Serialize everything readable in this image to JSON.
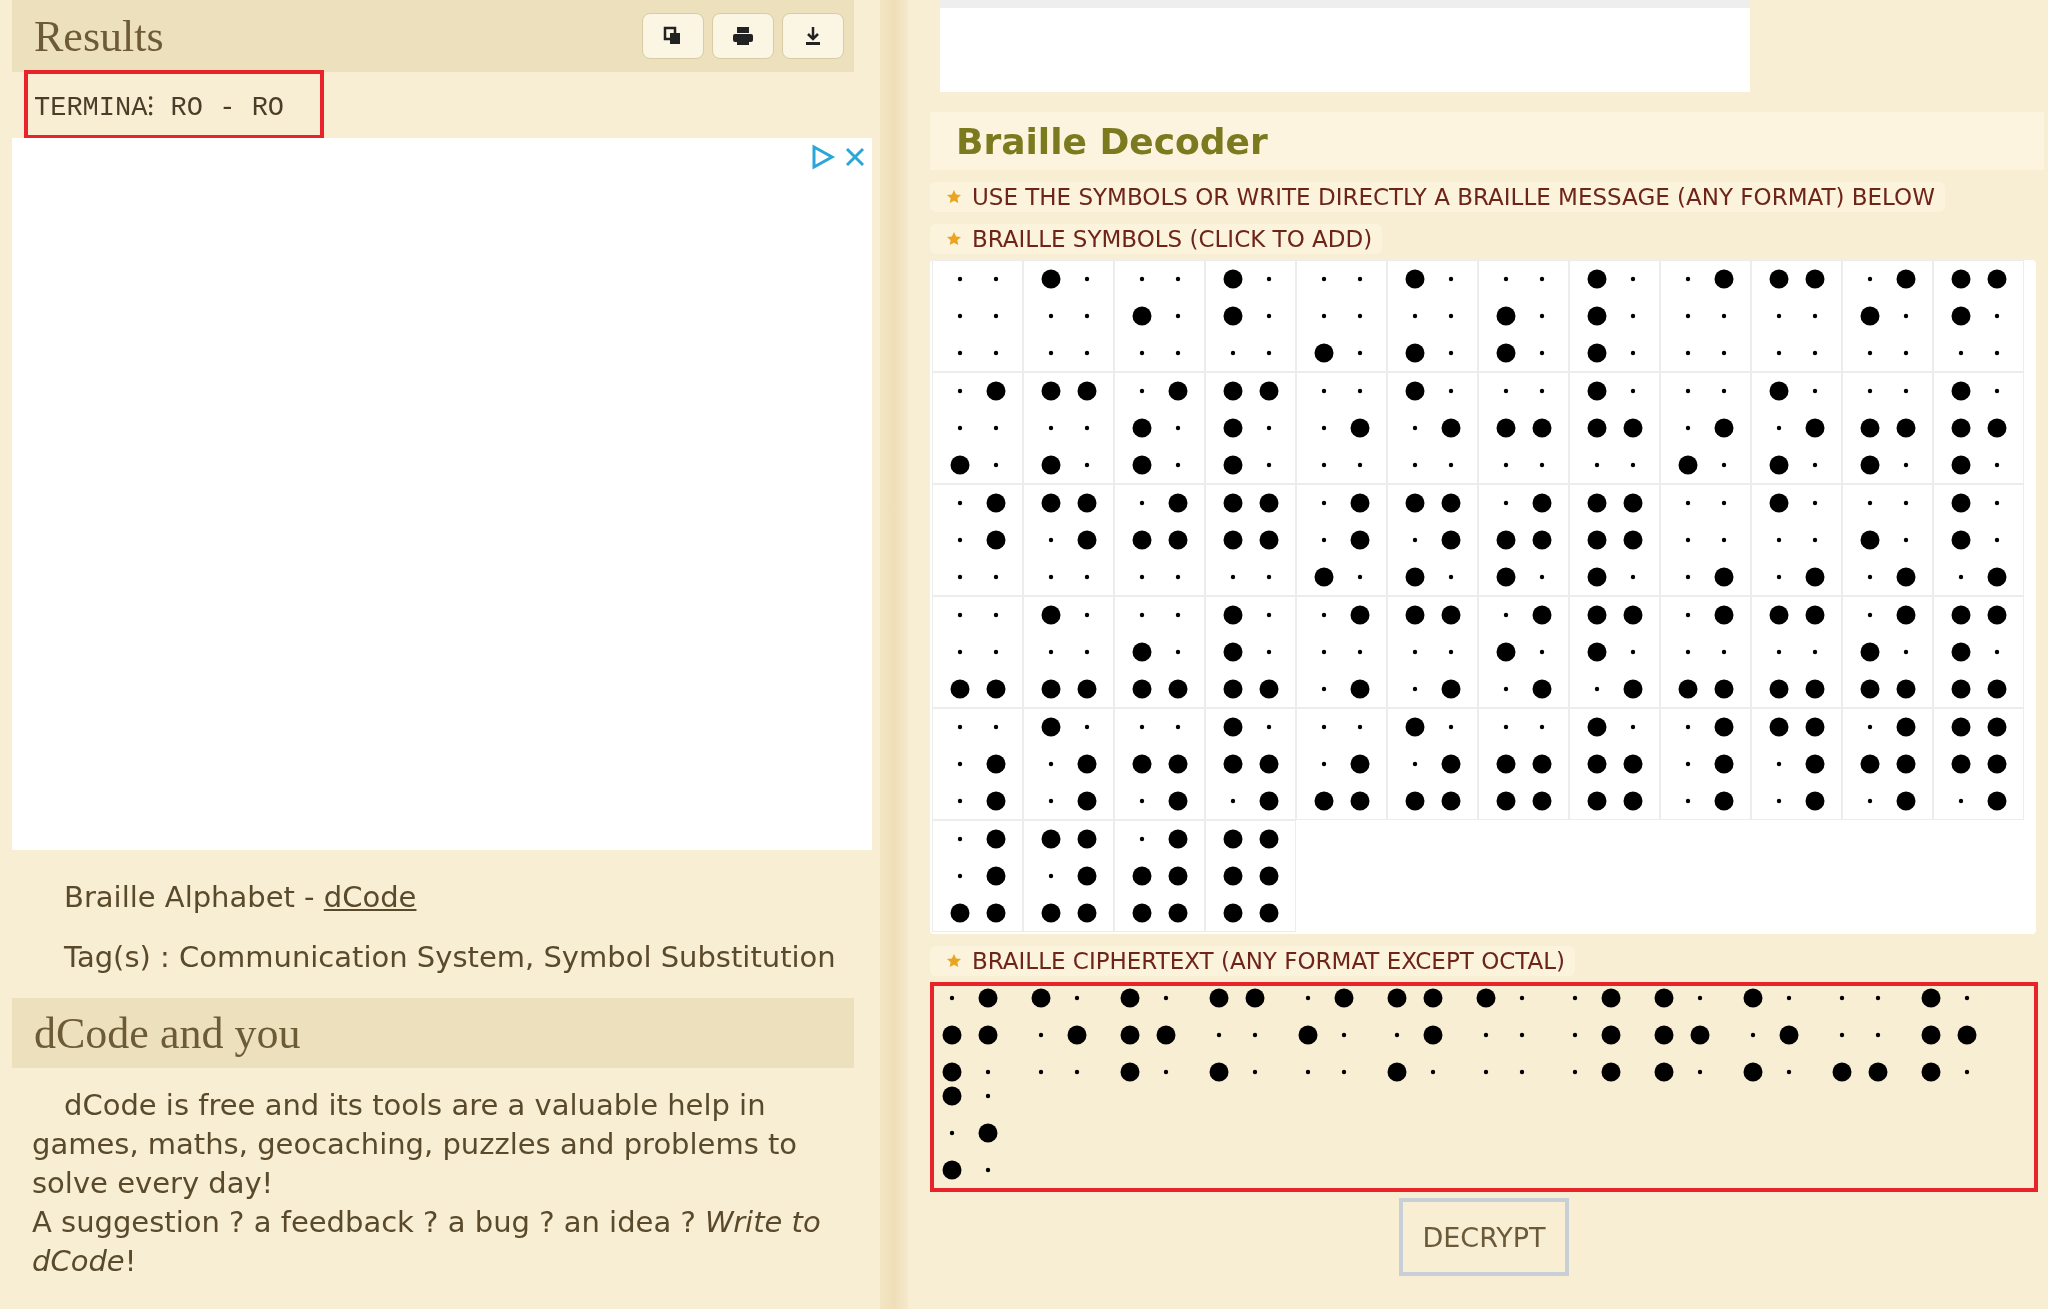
{
  "results": {
    "title": "Results",
    "buttons": [
      {
        "kind": "copy"
      },
      {
        "kind": "print"
      },
      {
        "kind": "download"
      }
    ],
    "output": "TERMINA⁝ RO - RO"
  },
  "page_info": {
    "title_prefix": "Braille Alphabet - ",
    "title_link": "dCode",
    "tags": "Tag(s) : Communication System, Symbol Substitution"
  },
  "about": {
    "title": "dCode and you",
    "text": "dCode is free and its tools are a valuable help in games, maths, geocaching, puzzles and problems to solve every day!",
    "suggestion": "A suggestion ? a feedback ? a bug ? an idea ? *Write to dCode*!"
  },
  "decoder": {
    "title": "Braille Decoder",
    "instruction": "USE THE SYMBOLS OR WRITE DIRECTLY A BRAILLE MESSAGE (ANY FORMAT) BELOW",
    "symbols_label": "BRAILLE SYMBOLS (CLICK TO ADD)",
    "symbols": [
      {
        "dots": [
          false,
          false,
          false,
          false,
          false,
          false
        ]
      },
      {
        "dots": [
          true,
          false,
          false,
          false,
          false,
          false
        ]
      },
      {
        "dots": [
          false,
          true,
          false,
          false,
          false,
          false
        ]
      },
      {
        "dots": [
          true,
          true,
          false,
          false,
          false,
          false
        ]
      },
      {
        "dots": [
          false,
          false,
          true,
          false,
          false,
          false
        ]
      },
      {
        "dots": [
          true,
          false,
          true,
          false,
          false,
          false
        ]
      },
      {
        "dots": [
          false,
          true,
          true,
          false,
          false,
          false
        ]
      },
      {
        "dots": [
          true,
          true,
          true,
          false,
          false,
          false
        ]
      },
      {
        "dots": [
          false,
          false,
          false,
          true,
          false,
          false
        ]
      },
      {
        "dots": [
          true,
          false,
          false,
          true,
          false,
          false
        ]
      },
      {
        "dots": [
          false,
          true,
          false,
          true,
          false,
          false
        ]
      },
      {
        "dots": [
          true,
          true,
          false,
          true,
          false,
          false
        ]
      },
      {
        "dots": [
          false,
          false,
          true,
          true,
          false,
          false
        ]
      },
      {
        "dots": [
          true,
          false,
          true,
          true,
          false,
          false
        ]
      },
      {
        "dots": [
          false,
          true,
          true,
          true,
          false,
          false
        ]
      },
      {
        "dots": [
          true,
          true,
          true,
          true,
          false,
          false
        ]
      },
      {
        "dots": [
          false,
          false,
          false,
          false,
          true,
          false
        ]
      },
      {
        "dots": [
          true,
          false,
          false,
          false,
          true,
          false
        ]
      },
      {
        "dots": [
          false,
          true,
          false,
          false,
          true,
          false
        ]
      },
      {
        "dots": [
          true,
          true,
          false,
          false,
          true,
          false
        ]
      },
      {
        "dots": [
          false,
          false,
          true,
          false,
          true,
          false
        ]
      },
      {
        "dots": [
          true,
          false,
          true,
          false,
          true,
          false
        ]
      },
      {
        "dots": [
          false,
          true,
          true,
          false,
          true,
          false
        ]
      },
      {
        "dots": [
          true,
          true,
          true,
          false,
          true,
          false
        ]
      },
      {
        "dots": [
          false,
          false,
          false,
          true,
          true,
          false
        ]
      },
      {
        "dots": [
          true,
          false,
          false,
          true,
          true,
          false
        ]
      },
      {
        "dots": [
          false,
          true,
          false,
          true,
          true,
          false
        ]
      },
      {
        "dots": [
          true,
          true,
          false,
          true,
          true,
          false
        ]
      },
      {
        "dots": [
          false,
          false,
          true,
          true,
          true,
          false
        ]
      },
      {
        "dots": [
          true,
          false,
          true,
          true,
          true,
          false
        ]
      },
      {
        "dots": [
          false,
          true,
          true,
          true,
          true,
          false
        ]
      },
      {
        "dots": [
          true,
          true,
          true,
          true,
          true,
          false
        ]
      },
      {
        "dots": [
          false,
          false,
          false,
          false,
          false,
          true
        ]
      },
      {
        "dots": [
          true,
          false,
          false,
          false,
          false,
          true
        ]
      },
      {
        "dots": [
          false,
          true,
          false,
          false,
          false,
          true
        ]
      },
      {
        "dots": [
          true,
          true,
          false,
          false,
          false,
          true
        ]
      },
      {
        "dots": [
          false,
          false,
          true,
          false,
          false,
          true
        ]
      },
      {
        "dots": [
          true,
          false,
          true,
          false,
          false,
          true
        ]
      },
      {
        "dots": [
          false,
          true,
          true,
          false,
          false,
          true
        ]
      },
      {
        "dots": [
          true,
          true,
          true,
          false,
          false,
          true
        ]
      },
      {
        "dots": [
          false,
          false,
          false,
          true,
          false,
          true
        ]
      },
      {
        "dots": [
          true,
          false,
          false,
          true,
          false,
          true
        ]
      },
      {
        "dots": [
          false,
          true,
          false,
          true,
          false,
          true
        ]
      },
      {
        "dots": [
          true,
          true,
          false,
          true,
          false,
          true
        ]
      },
      {
        "dots": [
          false,
          false,
          true,
          true,
          false,
          true
        ]
      },
      {
        "dots": [
          true,
          false,
          true,
          true,
          false,
          true
        ]
      },
      {
        "dots": [
          false,
          true,
          true,
          true,
          false,
          true
        ]
      },
      {
        "dots": [
          true,
          true,
          true,
          true,
          false,
          true
        ]
      },
      {
        "dots": [
          false,
          false,
          false,
          false,
          true,
          true
        ]
      },
      {
        "dots": [
          true,
          false,
          false,
          false,
          true,
          true
        ]
      },
      {
        "dots": [
          false,
          true,
          false,
          false,
          true,
          true
        ]
      },
      {
        "dots": [
          true,
          true,
          false,
          false,
          true,
          true
        ]
      },
      {
        "dots": [
          false,
          false,
          true,
          false,
          true,
          true
        ]
      },
      {
        "dots": [
          true,
          false,
          true,
          false,
          true,
          true
        ]
      },
      {
        "dots": [
          false,
          true,
          true,
          false,
          true,
          true
        ]
      },
      {
        "dots": [
          true,
          true,
          true,
          false,
          true,
          true
        ]
      },
      {
        "dots": [
          false,
          false,
          false,
          true,
          true,
          true
        ]
      },
      {
        "dots": [
          true,
          false,
          false,
          true,
          true,
          true
        ]
      },
      {
        "dots": [
          false,
          true,
          false,
          true,
          true,
          true
        ]
      },
      {
        "dots": [
          true,
          true,
          false,
          true,
          true,
          true
        ]
      },
      {
        "dots": [
          false,
          false,
          true,
          true,
          true,
          true
        ]
      },
      {
        "dots": [
          true,
          false,
          true,
          true,
          true,
          true
        ]
      },
      {
        "dots": [
          false,
          true,
          true,
          true,
          true,
          true
        ]
      },
      {
        "dots": [
          true,
          true,
          true,
          true,
          true,
          true
        ]
      }
    ],
    "ciphertext_label": "BRAILLE CIPHERTEXT (ANY FORMAT EXCEPT OCTAL)",
    "ciphertext": [
      {
        "dots": [
          false,
          true,
          true,
          true,
          true,
          false
        ]
      },
      {
        "dots": [
          true,
          false,
          false,
          false,
          true,
          false
        ]
      },
      {
        "dots": [
          true,
          true,
          true,
          false,
          true,
          false
        ]
      },
      {
        "dots": [
          true,
          false,
          true,
          true,
          false,
          false
        ]
      },
      {
        "dots": [
          false,
          true,
          false,
          true,
          false,
          false
        ]
      },
      {
        "dots": [
          true,
          false,
          true,
          true,
          true,
          false
        ]
      },
      {
        "dots": [
          true,
          false,
          false,
          false,
          false,
          false
        ]
      },
      {
        "dots": [
          false,
          false,
          false,
          true,
          true,
          true
        ]
      },
      {
        "dots": [
          true,
          true,
          true,
          false,
          true,
          false
        ]
      },
      {
        "dots": [
          true,
          false,
          true,
          false,
          true,
          false
        ]
      },
      {
        "dots": [
          false,
          false,
          true,
          false,
          false,
          true
        ]
      },
      {
        "dots": [
          true,
          true,
          true,
          false,
          true,
          false
        ]
      },
      {
        "dots": [
          true,
          false,
          true,
          false,
          true,
          false
        ]
      }
    ],
    "button": "DECRYPT"
  }
}
